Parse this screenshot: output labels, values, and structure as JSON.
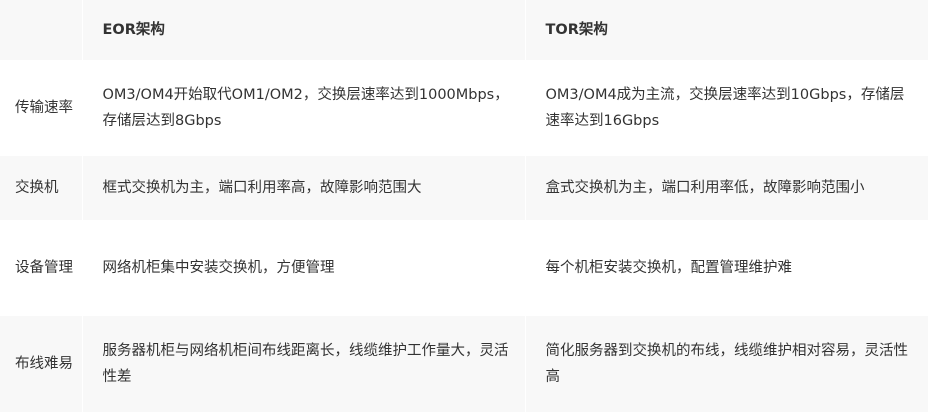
{
  "table": {
    "headers": {
      "corner": "",
      "eor": "EOR架构",
      "tor": "TOR架构"
    },
    "rows": [
      {
        "label": "传输速率",
        "eor": "OM3/OM4开始取代OM1/OM2，交换层速率达到1000Mbps，存储层达到8Gbps",
        "tor": "OM3/OM4成为主流，交换层速率达到10Gbps，存储层速率达到16Gbps"
      },
      {
        "label": "交换机",
        "eor": "框式交换机为主，端口利用率高，故障影响范围大",
        "tor": "盒式交换机为主，端口利用率低，故障影响范围小"
      },
      {
        "label": "设备管理",
        "eor": "网络机柜集中安装交换机，方便管理",
        "tor": "每个机柜安装交换机，配置管理维护难"
      },
      {
        "label": "布线难易",
        "eor": "服务器机柜与网络机柜间布线距离长，线缆维护工作量大，灵活性差",
        "tor": "简化服务器到交换机的布线，线缆维护相对容易，灵活性高"
      }
    ]
  }
}
